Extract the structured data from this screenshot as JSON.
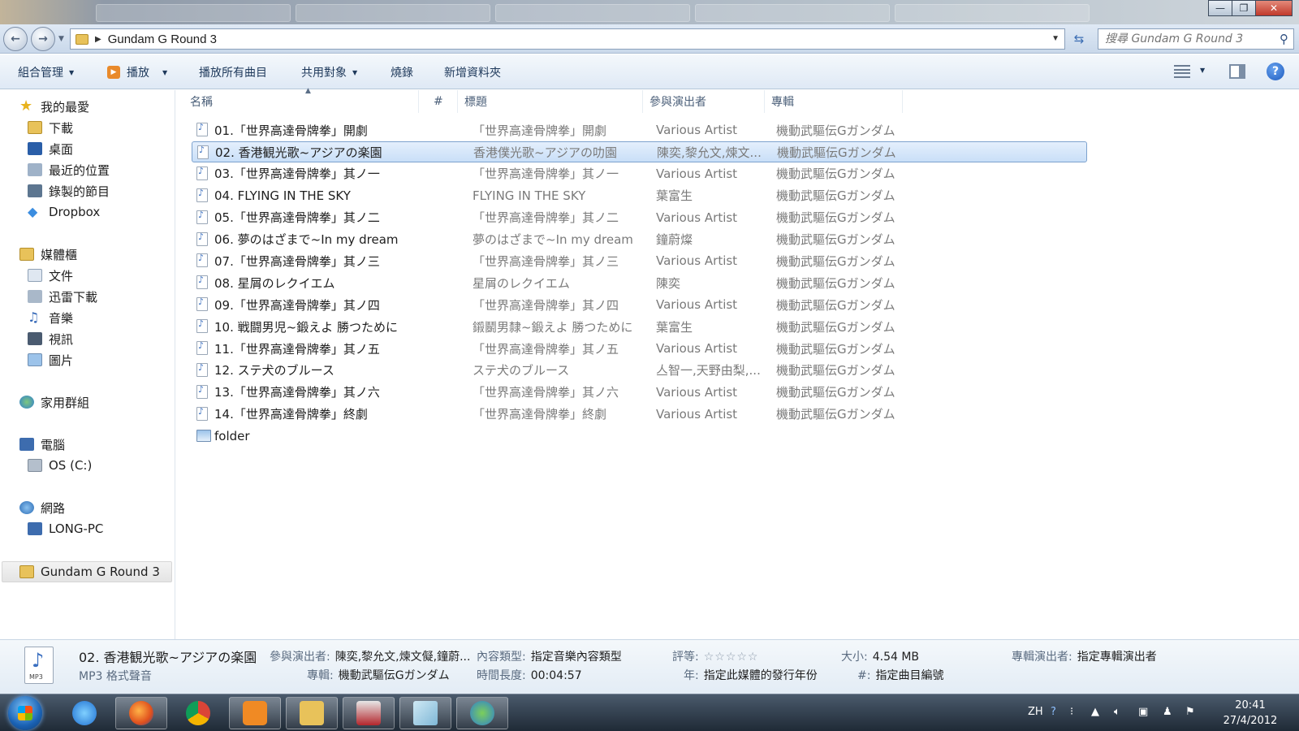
{
  "address": {
    "path": "Gundam G Round 3",
    "search_placeholder": "搜尋 Gundam G Round 3"
  },
  "toolbar": {
    "organize": "組合管理",
    "play": "播放",
    "play_all": "播放所有曲目",
    "share": "共用對象",
    "burn": "燒錄",
    "new_folder": "新增資料夾"
  },
  "nav": {
    "favorites": "我的最愛",
    "downloads": "下載",
    "desktop": "桌面",
    "recent": "最近的位置",
    "recorded_tv": "錄製的節目",
    "dropbox": "Dropbox",
    "libraries": "媒體櫃",
    "documents": "文件",
    "thunder": "迅雷下載",
    "music": "音樂",
    "videos": "視訊",
    "pictures": "圖片",
    "homegroup": "家用群組",
    "computer": "電腦",
    "os_drive": "OS (C:)",
    "network": "網路",
    "long_pc": "LONG-PC",
    "current_folder": "Gundam G Round 3"
  },
  "columns": {
    "name": "名稱",
    "number": "#",
    "title": "標題",
    "artist": "參與演出者",
    "album": "專輯"
  },
  "files": [
    {
      "name": "01.「世界高達骨牌拳」開劇",
      "title": "「世界高達骨牌拳」開劇",
      "artist": "Various Artist",
      "album": "機動武驅伝Gガンダム"
    },
    {
      "name": "02. 香港観光歌~アジアの楽園",
      "title": "香港僕光歌~アジアの叻園",
      "artist": "陳奕,黎允文,煉文...",
      "album": "機動武驅伝Gガンダム"
    },
    {
      "name": "03.「世界高達骨牌拳」其ノ一",
      "title": "「世界高達骨牌拳」其ノ一",
      "artist": "Various Artist",
      "album": "機動武驅伝Gガンダム"
    },
    {
      "name": "04. FLYING IN THE SKY",
      "title": "FLYING IN THE SKY",
      "artist": "葉富生",
      "album": "機動武驅伝Gガンダム"
    },
    {
      "name": "05.「世界高達骨牌拳」其ノ二",
      "title": "「世界高達骨牌拳」其ノ二",
      "artist": "Various Artist",
      "album": "機動武驅伝Gガンダム"
    },
    {
      "name": "06. 夢のはざまで~In my dream",
      "title": "夢のはざまで~In my dream",
      "artist": "鐘蔚燦",
      "album": "機動武驅伝Gガンダム"
    },
    {
      "name": "07.「世界高達骨牌拳」其ノ三",
      "title": "「世界高達骨牌拳」其ノ三",
      "artist": "Various Artist",
      "album": "機動武驅伝Gガンダム"
    },
    {
      "name": "08. 星屑のレクイエム",
      "title": "星屑のレクイエム",
      "artist": "陳奕",
      "album": "機動武驅伝Gガンダム"
    },
    {
      "name": "09.「世界高達骨牌拳」其ノ四",
      "title": "「世界高達骨牌拳」其ノ四",
      "artist": "Various Artist",
      "album": "機動武驅伝Gガンダム"
    },
    {
      "name": "10. 戦闘男児~鍛えよ 勝つために",
      "title": "鎩鬭男隸~鍛えよ 勝つために",
      "artist": "葉富生",
      "album": "機動武驅伝Gガンダム"
    },
    {
      "name": "11.「世界高達骨牌拳」其ノ五",
      "title": "「世界高達骨牌拳」其ノ五",
      "artist": "Various Artist",
      "album": "機動武驅伝Gガンダム"
    },
    {
      "name": "12. ステ犬のブルース",
      "title": "ステ犬のブルース",
      "artist": "亼智一,天野由梨,...",
      "album": "機動武驅伝Gガンダム"
    },
    {
      "name": "13.「世界高達骨牌拳」其ノ六",
      "title": "「世界高達骨牌拳」其ノ六",
      "artist": "Various Artist",
      "album": "機動武驅伝Gガンダム"
    },
    {
      "name": "14.「世界高達骨牌拳」終劇",
      "title": "「世界高達骨牌拳」終劇",
      "artist": "Various Artist",
      "album": "機動武驅伝Gガンダム"
    },
    {
      "name": "folder",
      "title": "",
      "artist": "",
      "album": ""
    }
  ],
  "details": {
    "icon_label": "MP3",
    "name": "02. 香港観光歌~アジアの楽園",
    "type": "MP3 格式聲音",
    "artist_label": "參與演出者:",
    "artist_value": "陳奕,黎允文,煉文儗,鐘蔚...",
    "album_label": "專輯:",
    "album_value": "機動武驅伝Gガンダム",
    "content_type_label": "內容類型:",
    "content_type_value": "指定音樂內容類型",
    "length_label": "時間長度:",
    "length_value": "00:04:57",
    "rating_label": "評等:",
    "rating_stars": "☆☆☆☆☆",
    "year_label": "年:",
    "year_value": "指定此媒體的發行年份",
    "size_label": "大小:",
    "size_value": "4.54 MB",
    "track_label": "#:",
    "track_value": "指定曲目編號",
    "album_artist_label": "專輯演出者:",
    "album_artist_value": "指定專輯演出者"
  },
  "taskbar": {
    "lang": "ZH",
    "time": "20:41",
    "date": "27/4/2012"
  },
  "icons": [
    "search-icon",
    "refresh-icon",
    "help-icon",
    "view-icon",
    "preview-pane-icon",
    "star-icon",
    "folder-icon",
    "music-file-icon",
    "image-file-icon",
    "start-orb-icon",
    "ie-icon",
    "firefox-icon",
    "chrome-icon",
    "media-player-icon",
    "explorer-icon",
    "gundam-icon",
    "notes-icon",
    "messenger-icon",
    "volume-icon",
    "network-icon",
    "flag-icon"
  ],
  "colors": {
    "selection": "#c9dff8",
    "selection_border": "#7da2ce",
    "toolbar_text": "#1e395b",
    "muted_text": "#7a7a7a"
  }
}
